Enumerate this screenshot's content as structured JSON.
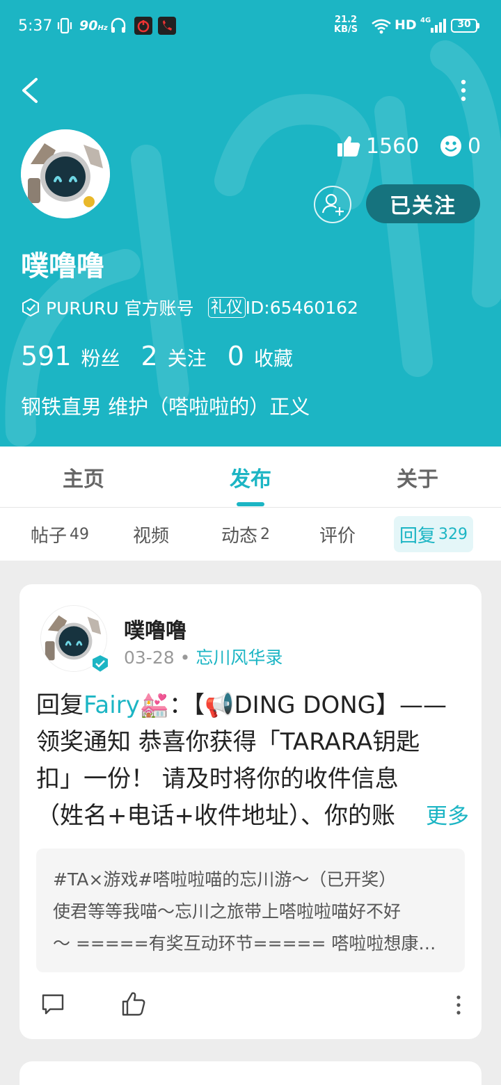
{
  "status_bar": {
    "time": "5:37",
    "refresh_rate": "90",
    "refresh_unit": "Hz",
    "net_rate_value": "21.2",
    "net_rate_unit": "KB/S",
    "hd": "HD",
    "network": "4G",
    "battery": "30"
  },
  "profile": {
    "likes": "1560",
    "smiles": "0",
    "follow_label": "已关注",
    "name": "噗噜噜",
    "official_label": "PURURU 官方账号",
    "etiquette_badge": "礼仪",
    "id_text": "ID:65460162",
    "bio": "钢铁直男 维护（嗒啦啦的）正义",
    "stats": [
      {
        "value": "591",
        "label": "粉丝"
      },
      {
        "value": "2",
        "label": "关注"
      },
      {
        "value": "0",
        "label": "收藏"
      }
    ]
  },
  "tabs": [
    {
      "label": "主页"
    },
    {
      "label": "发布"
    },
    {
      "label": "关于"
    }
  ],
  "active_tab": "发布",
  "subtabs": [
    {
      "label": "帖子",
      "count": "49"
    },
    {
      "label": "视频",
      "count": ""
    },
    {
      "label": "动态",
      "count": "2"
    },
    {
      "label": "评价",
      "count": ""
    },
    {
      "label": "回复",
      "count": "329"
    }
  ],
  "active_subtab": "回复",
  "post": {
    "author": "噗噜噜",
    "date": "03-28",
    "topic": "忘川风华录",
    "reply_prefix": "回复",
    "reply_to": "Fairy💒",
    "body_l1": "：【📢DING DONG】——",
    "body_l2": "领奖通知 恭喜你获得「TARARA钥匙",
    "body_l3": "扣」一份！ 请及时将你的收件信息",
    "body_l4": "（姓名+电话+收件地址）、你的账",
    "more_label": "更多",
    "quote_title": "#TA×游戏#嗒啦啦喵的忘川游～（已开奖）",
    "quote_line1": "使君等等我喵～忘川之旅带上嗒啦啦喵好不好",
    "quote_line2": "～ =====有奖互动环节===== 嗒啦啦想康康…"
  },
  "colors": {
    "accent": "#1cb5c4",
    "follow_button": "#16737e",
    "page_background": "#ededed"
  },
  "icons": [
    "back-arrow-icon",
    "more-vertical-icon",
    "thumb-up-icon",
    "smile-icon",
    "add-friend-icon",
    "verified-shield-icon",
    "comment-icon",
    "like-icon",
    "kebab-icon"
  ]
}
